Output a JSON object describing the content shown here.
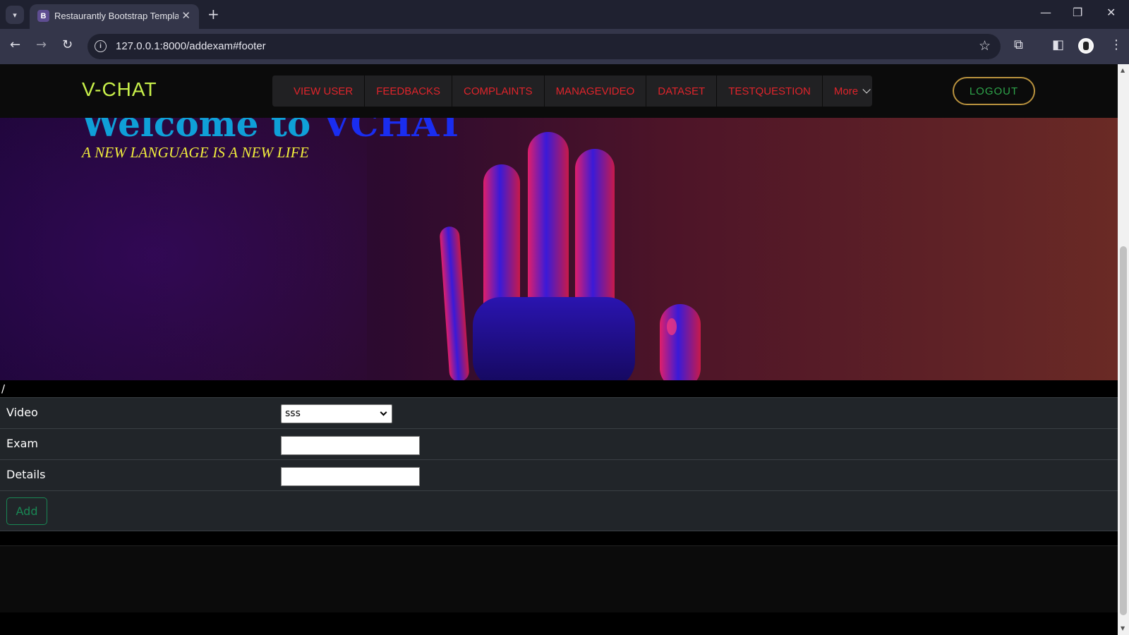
{
  "browser": {
    "tab_title": "Restaurantly Bootstrap Template",
    "tab_favicon": "B",
    "url": "127.0.0.1:8000/addexam#footer"
  },
  "site": {
    "logo": "V-CHAT",
    "nav": [
      "VIEW USER",
      "FEEDBACKS",
      "COMPLAINTS",
      "MANAGEVIDEO",
      "DATASET",
      "TESTQUESTION",
      "More"
    ],
    "logout": "LOGOUT",
    "hero_title_prefix": "Welcome to ",
    "hero_title_brand": "VCHAT",
    "hero_subtitle": "A NEW LANGUAGE IS A NEW LIFE"
  },
  "form": {
    "slash": "/",
    "video_label": "Video",
    "video_selected": "sss",
    "exam_label": "Exam",
    "exam_value": "",
    "details_label": "Details",
    "details_value": "",
    "add_button": "Add"
  },
  "colors": {
    "logo": "#c8f04a",
    "nav_text": "#e0242b",
    "hero_title": "#0fa0d8",
    "hero_brand": "#1a2df0",
    "hero_subtitle": "#f2ee3c",
    "logout_border": "#b9923e",
    "logout_text": "#2ea44a",
    "add_button": "#198754"
  },
  "icons": [
    "tab-list-icon",
    "favicon-icon",
    "close-tab-icon",
    "new-tab-icon",
    "minimize-icon",
    "restore-icon",
    "close-window-icon",
    "back-icon",
    "forward-icon",
    "reload-icon",
    "site-info-icon",
    "bookmark-star-icon",
    "extensions-icon",
    "side-panel-icon",
    "profile-avatar-icon",
    "menu-icon",
    "chevron-down-icon"
  ]
}
